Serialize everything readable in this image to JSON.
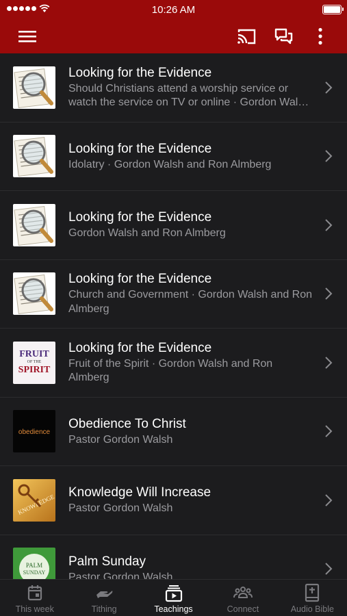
{
  "status_bar": {
    "time": "10:26 AM"
  },
  "nav_bar": {
    "icons": [
      "menu-icon",
      "cast-icon",
      "chat-icon",
      "more-vertical-icon"
    ]
  },
  "items": [
    {
      "title": "Looking for the Evidence",
      "subtitle": "Should Christians attend a worship service or watch the service on TV or online · Gordon Walsh and Ron Almberg",
      "thumb": "newspaper-magnifier"
    },
    {
      "title": "Looking for the Evidence",
      "subtitle": "Idolatry · Gordon Walsh and Ron Almberg",
      "thumb": "newspaper-magnifier"
    },
    {
      "title": "Looking for the Evidence",
      "subtitle": "Gordon Walsh and Ron Almberg",
      "thumb": "newspaper-magnifier"
    },
    {
      "title": "Looking for the Evidence",
      "subtitle": "Church and Government · Gordon Walsh and Ron Almberg",
      "thumb": "newspaper-magnifier"
    },
    {
      "title": "Looking for the Evidence",
      "subtitle": "Fruit of the Spirit · Gordon Walsh and Ron Almberg",
      "thumb": "fruit-of-the-spirit",
      "thumb_text": {
        "line1": "FRUIT",
        "line2": "OF THE",
        "line3": "SPIRIT"
      }
    },
    {
      "title": "Obedience To Christ",
      "subtitle": "Pastor Gordon Walsh",
      "thumb": "obedience",
      "thumb_text": {
        "line1": "obedience"
      }
    },
    {
      "title": "Knowledge Will Increase",
      "subtitle": "Pastor Gordon Walsh",
      "thumb": "knowledge-key",
      "thumb_text": {
        "line1": "KNOWLEDGE"
      }
    },
    {
      "title": "Palm Sunday",
      "subtitle": "Pastor Gordon Walsh",
      "thumb": "palm-sunday",
      "thumb_text": {
        "line1": "PALM",
        "line2": "SUNDAY"
      }
    }
  ],
  "tabs": [
    {
      "label": "This week",
      "icon": "calendar-icon",
      "active": false
    },
    {
      "label": "Tithing",
      "icon": "hand-icon",
      "active": false
    },
    {
      "label": "Teachings",
      "icon": "play-playlist-icon",
      "active": true
    },
    {
      "label": "Connect",
      "icon": "people-icon",
      "active": false
    },
    {
      "label": "Audio Bible",
      "icon": "bible-icon",
      "active": false
    }
  ],
  "colors": {
    "brand": "#9a0a0a",
    "background": "#1c1c1e",
    "secondary_text": "#9b9b9f",
    "inactive_tab": "#7a7a7e"
  }
}
